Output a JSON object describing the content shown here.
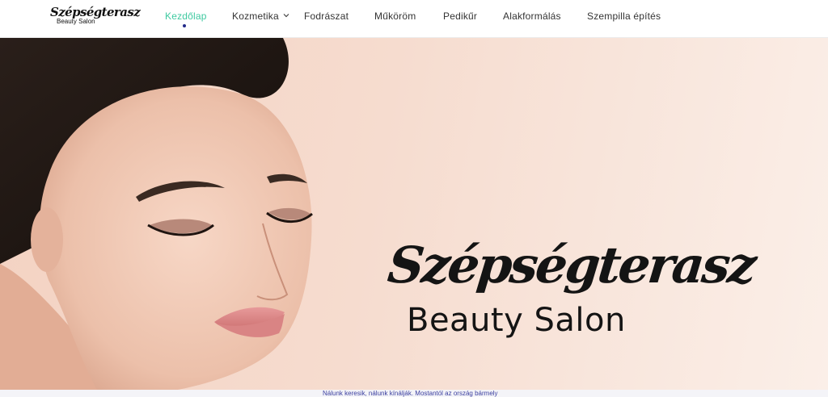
{
  "header": {
    "logo": {
      "script": "Szépségterasz",
      "subtitle": "Beauty Salon"
    },
    "nav": [
      {
        "label": "Kezdőlap",
        "active": true
      },
      {
        "label": "Kozmetika",
        "has_dropdown": true
      },
      {
        "label": "Fodrászat"
      },
      {
        "label": "Műköröm"
      },
      {
        "label": "Pedikűr"
      },
      {
        "label": "Alakformálás"
      },
      {
        "label": "Szempilla építés"
      }
    ],
    "colors": {
      "active": "#3ec9a0",
      "indicator": "#232a8a",
      "text": "#333333"
    }
  },
  "hero": {
    "title": "Szépségterasz",
    "subtitle": "Beauty Salon",
    "image": "woman-face-portrait"
  },
  "marquee": {
    "text": "Nálunk keresik, nálunk kínálják. Mostantól az ország bármely"
  }
}
